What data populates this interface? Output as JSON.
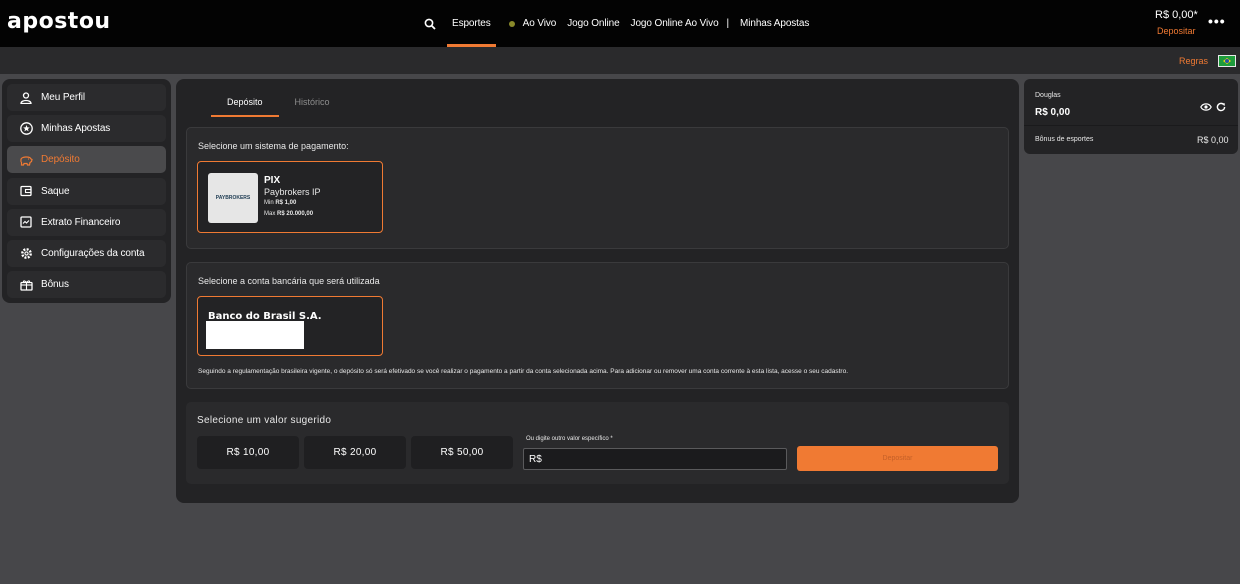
{
  "header": {
    "logo": "apostou",
    "nav": [
      {
        "label": "Esportes",
        "active": true
      },
      {
        "label": "Ao Vivo"
      },
      {
        "label": "Jogo Online"
      },
      {
        "label": "Jogo Online Ao Vivo"
      },
      {
        "label": "|"
      },
      {
        "label": "Minhas Apostas"
      }
    ],
    "balance": "R$ 0,00*",
    "deposit_link": "Depositar",
    "more": "•••",
    "rules": "Regras"
  },
  "sidebar": {
    "items": [
      {
        "label": "Meu Perfil",
        "icon": "user-icon"
      },
      {
        "label": "Minhas Apostas",
        "icon": "star-icon"
      },
      {
        "label": "Depósito",
        "icon": "piggy-bank-icon",
        "active": true
      },
      {
        "label": "Saque",
        "icon": "wallet-icon"
      },
      {
        "label": "Extrato Financeiro",
        "icon": "statement-icon"
      },
      {
        "label": "Configurações da conta",
        "icon": "gear-icon"
      },
      {
        "label": "Bônus",
        "icon": "gift-icon"
      }
    ]
  },
  "main": {
    "tabs": [
      {
        "label": "Depósito",
        "active": true
      },
      {
        "label": "Histórico"
      }
    ],
    "payment": {
      "title": "Selecione um sistema de pagamento:",
      "logo_text": "PAYBROKERS",
      "name": "PIX",
      "provider": "Paybrokers IP",
      "min_label": "Min",
      "min_value": "R$ 1,00",
      "max_label": "Max",
      "max_value": "R$ 20.000,00"
    },
    "bank": {
      "title": "Selecione a conta bancária que será utilizada",
      "name": "Banco do Brasil S.A.",
      "note": "Seguindo a regulamentação brasileira vigente, o depósito só será efetivado se você realizar o pagamento a partir da conta selecionada acima. Para adicionar ou remover uma conta corrente à esta lista, acesse o seu cadastro."
    },
    "amount": {
      "title": "Selecione um valor sugerido",
      "options": [
        "R$ 10,00",
        "R$ 20,00",
        "R$ 50,00"
      ],
      "other_label": "Ou digite outro valor específico *",
      "input_value": "R$",
      "deposit_button": "Depositar"
    }
  },
  "account": {
    "user": "Douglas",
    "balance": "R$ 0,00",
    "bonus_label": "Bônus de esportes",
    "bonus_value": "R$ 0,00"
  },
  "colors": {
    "accent": "#f07a33",
    "background": "#47474a",
    "panel": "#232325"
  }
}
